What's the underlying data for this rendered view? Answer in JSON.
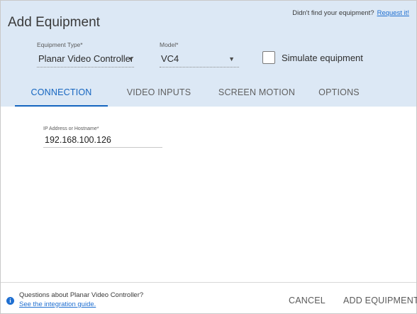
{
  "dialog": {
    "title": "Add Equipment",
    "help_text": "Didn't find your equipment?",
    "help_link": "Request it!"
  },
  "equipment_type": {
    "label": "Equipment Type*",
    "value": "Planar Video Controller"
  },
  "model": {
    "label": "Model*",
    "value": "VC4"
  },
  "simulate": {
    "label": "Simulate equipment",
    "checked": false
  },
  "tabs": [
    {
      "label": "CONNECTION",
      "active": true
    },
    {
      "label": "VIDEO INPUTS",
      "active": false
    },
    {
      "label": "SCREEN MOTION",
      "active": false
    },
    {
      "label": "OPTIONS",
      "active": false
    }
  ],
  "connection": {
    "ip_label": "IP Address or Hostname*",
    "ip_value": "192.168.100.126"
  },
  "footer": {
    "question": "Questions about Planar Video Controller?",
    "guide_link": "See the integration guide.",
    "cancel": "CANCEL",
    "add": "ADD EQUIPMENT"
  },
  "colors": {
    "header_bg": "#dce8f5",
    "accent": "#1565c0",
    "link": "#1f6fd1"
  }
}
